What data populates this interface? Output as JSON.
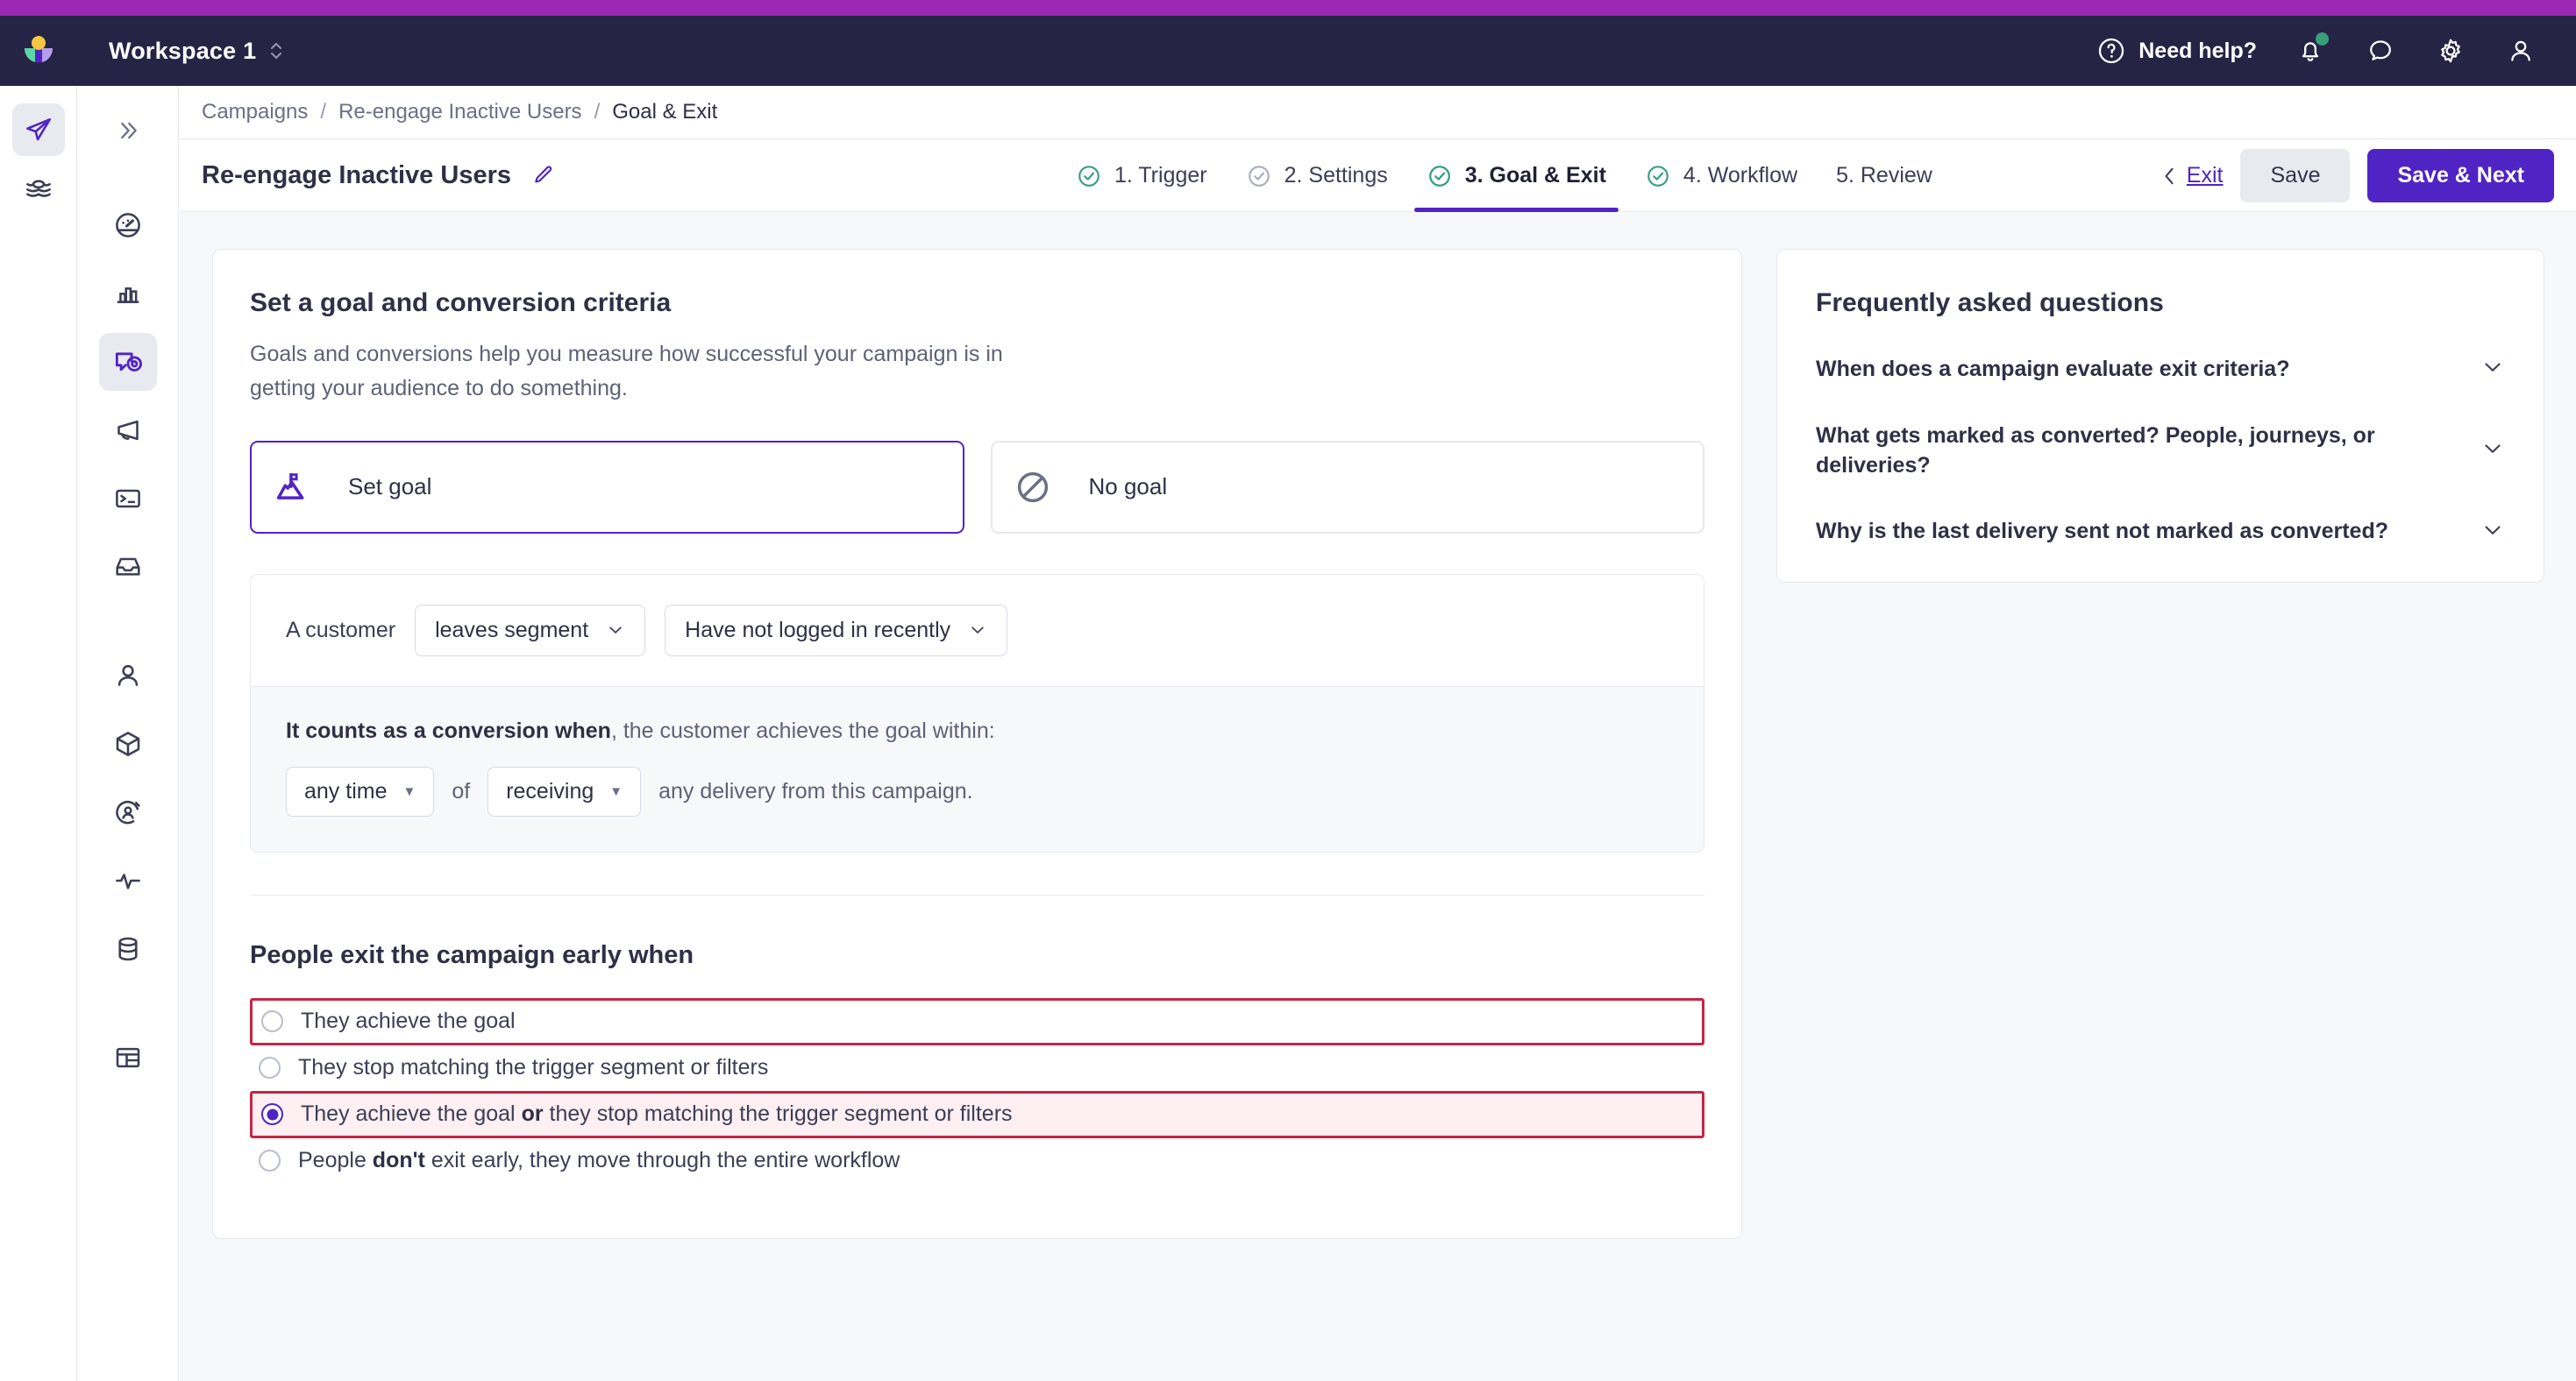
{
  "topbar": {
    "logo_name": "customerio-logo",
    "workspace": "Workspace 1",
    "need_help": "Need help?",
    "icons": [
      "help-circle-icon",
      "bell-icon",
      "chat-icon",
      "gear-icon",
      "user-icon"
    ],
    "notification_dot_color": "#35a07a",
    "background": "#262444",
    "strip_color": "#9c27b0"
  },
  "rail": {
    "items": [
      {
        "name": "paper-plane-icon",
        "active": true
      },
      {
        "name": "layers-icon",
        "active": false
      }
    ]
  },
  "nav": {
    "collapse": "chevrons-right-icon",
    "items": [
      {
        "name": "dashboard-gauge-icon",
        "active": false
      },
      {
        "name": "analytics-bar-chart-icon",
        "active": false
      },
      {
        "name": "campaigns-target-icon",
        "active": true
      },
      {
        "name": "broadcasts-megaphone-icon",
        "active": false
      },
      {
        "name": "transactional-terminal-icon",
        "active": false
      },
      {
        "name": "inbox-icon",
        "active": false
      },
      {
        "name": "people-icon",
        "active": false
      },
      {
        "name": "objects-cube-icon",
        "active": false
      },
      {
        "name": "segments-icon",
        "active": false
      },
      {
        "name": "activity-pulse-icon",
        "active": false
      },
      {
        "name": "data-index-icon",
        "active": false
      },
      {
        "name": "reports-table-icon",
        "active": false
      }
    ]
  },
  "breadcrumb": {
    "items": [
      "Campaigns",
      "Re-engage Inactive Users",
      "Goal & Exit"
    ],
    "separator": "/"
  },
  "header": {
    "campaign_title": "Re-engage Inactive Users",
    "edit_icon": "pencil-icon",
    "steps": [
      {
        "label": "1. Trigger",
        "state": "complete",
        "check_color": "#35a07a"
      },
      {
        "label": "2. Settings",
        "state": "visited",
        "check_color": "#a9abbd"
      },
      {
        "label": "3. Goal & Exit",
        "state": "active",
        "check_color": "#35a07a"
      },
      {
        "label": "4. Workflow",
        "state": "complete",
        "check_color": "#35a07a"
      },
      {
        "label": "5. Review",
        "state": "pending",
        "check_color": ""
      }
    ],
    "active_underline_color": "#5024c4",
    "exit_label": "Exit",
    "save_label": "Save",
    "save_next_label": "Save & Next"
  },
  "goal_section": {
    "title": "Set a goal and conversion criteria",
    "description": "Goals and conversions help you measure how successful your campaign is in getting your audience to do something.",
    "options": [
      {
        "label": "Set goal",
        "icon": "mountain-flag-icon",
        "selected": true
      },
      {
        "label": "No goal",
        "icon": "no-goal-slash-icon",
        "selected": false
      }
    ],
    "condition": {
      "prefix": "A customer",
      "event_select": "leaves segment",
      "segment_select": "Have not logged in recently"
    },
    "conversion": {
      "lead_bold": "It counts as a conversion when",
      "lead_rest": ", the customer achieves the goal within:",
      "window_select": "any time",
      "joiner": "of",
      "action_select": "receiving",
      "suffix": "any delivery from this campaign."
    }
  },
  "exit_section": {
    "title": "People exit the campaign early when",
    "options": [
      {
        "text": "They achieve the goal",
        "bold": "",
        "text_after": "",
        "selected": false,
        "highlight": "outline"
      },
      {
        "text": "They stop matching the trigger segment or filters",
        "bold": "",
        "text_after": "",
        "selected": false,
        "highlight": "none"
      },
      {
        "text": "They achieve the goal ",
        "bold": "or",
        "text_after": " they stop matching the trigger segment or filters",
        "selected": true,
        "highlight": "filled"
      },
      {
        "text": "People ",
        "bold": "don't",
        "text_after": " exit early, they move through the entire workflow",
        "selected": false,
        "highlight": "none"
      }
    ],
    "highlight_color": "#c62544",
    "highlight_fill": "#fdeff2"
  },
  "faq": {
    "title": "Frequently asked questions",
    "items": [
      {
        "question": "When does a campaign evaluate exit criteria?",
        "chevron": "chevron-down-icon"
      },
      {
        "question": "What gets marked as converted? People, journeys, or deliveries?",
        "chevron": "chevron-down-icon"
      },
      {
        "question": "Why is the last delivery sent not marked as converted?",
        "chevron": "chevron-down-icon"
      }
    ]
  },
  "theme": {
    "accent": "#5024c4",
    "page_bg": "#f7f8fa",
    "card_bg": "#ffffff",
    "border": "#e7e8ee",
    "text": "#2f3046",
    "muted": "#6b7085"
  }
}
